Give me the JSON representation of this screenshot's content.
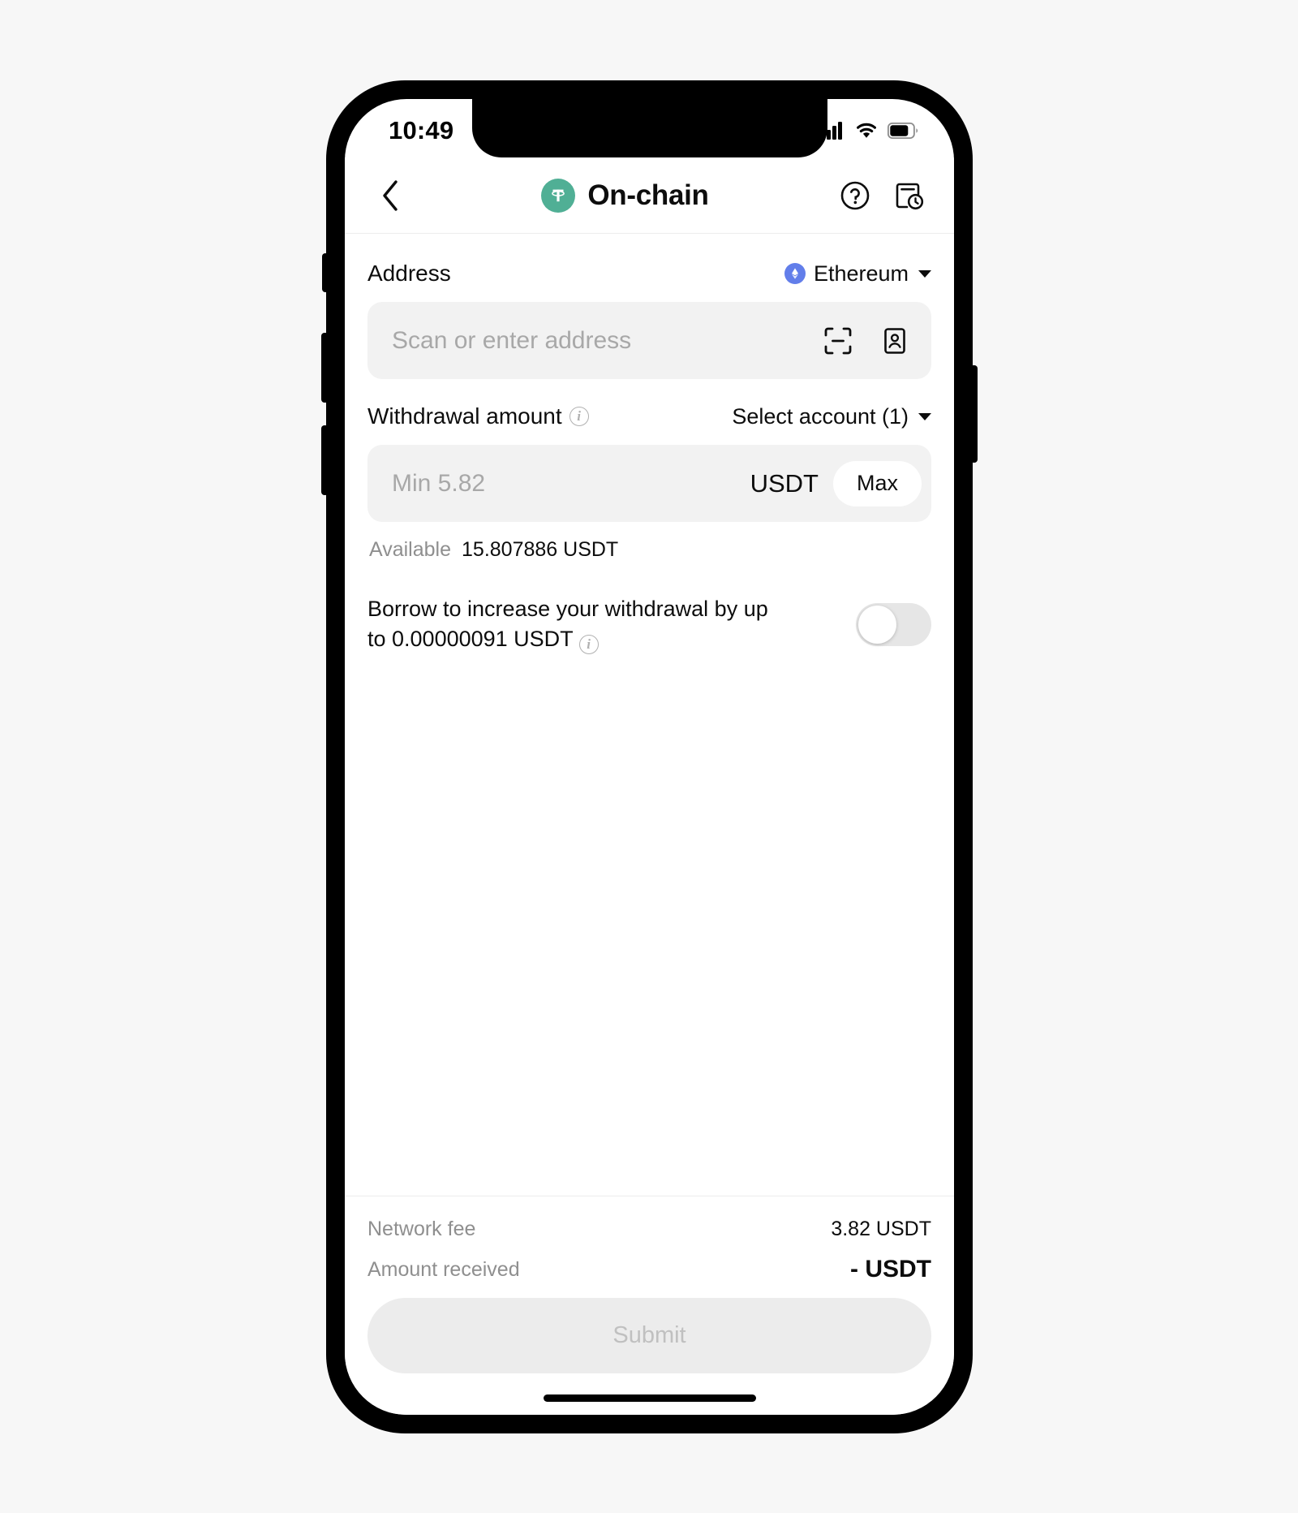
{
  "status_bar": {
    "time": "10:49",
    "icons": [
      "cellular-signal-icon",
      "wifi-icon",
      "battery-icon"
    ]
  },
  "header": {
    "back_icon": "chevron-left-icon",
    "token_logo": "usdt-tether-logo",
    "title": "On-chain",
    "help_icon": "question-circle-icon",
    "history_icon": "transaction-history-icon"
  },
  "address_section": {
    "label": "Address",
    "network": {
      "icon": "ethereum-logo",
      "name": "Ethereum",
      "caret": "chevron-down-icon"
    },
    "input_placeholder": "Scan or enter address",
    "input_value": "",
    "scan_icon": "qr-scan-icon",
    "contacts_icon": "address-book-icon"
  },
  "amount_section": {
    "label": "Withdrawal amount",
    "label_info_icon": "info-circle-icon",
    "account_selector": "Select account (1)",
    "account_caret": "chevron-down-icon",
    "input_placeholder": "Min 5.82",
    "input_value": "",
    "currency": "USDT",
    "max_label": "Max",
    "available_label": "Available",
    "available_value": "15.807886 USDT"
  },
  "borrow_section": {
    "text": "Borrow to increase your withdrawal by up to 0.00000091 USDT",
    "info_icon": "info-circle-icon",
    "toggle_state": "off"
  },
  "footer": {
    "rows": [
      {
        "label": "Network fee",
        "value": "3.82 USDT"
      },
      {
        "label": "Amount received",
        "value": "- USDT"
      }
    ],
    "submit_label": "Submit",
    "submit_enabled": false
  },
  "colors": {
    "usdt_green": "#50af95",
    "ethereum_blue": "#627eea",
    "field_background": "#f2f2f2",
    "disabled_button": "#ececec",
    "page_background": "#f7f7f7"
  }
}
